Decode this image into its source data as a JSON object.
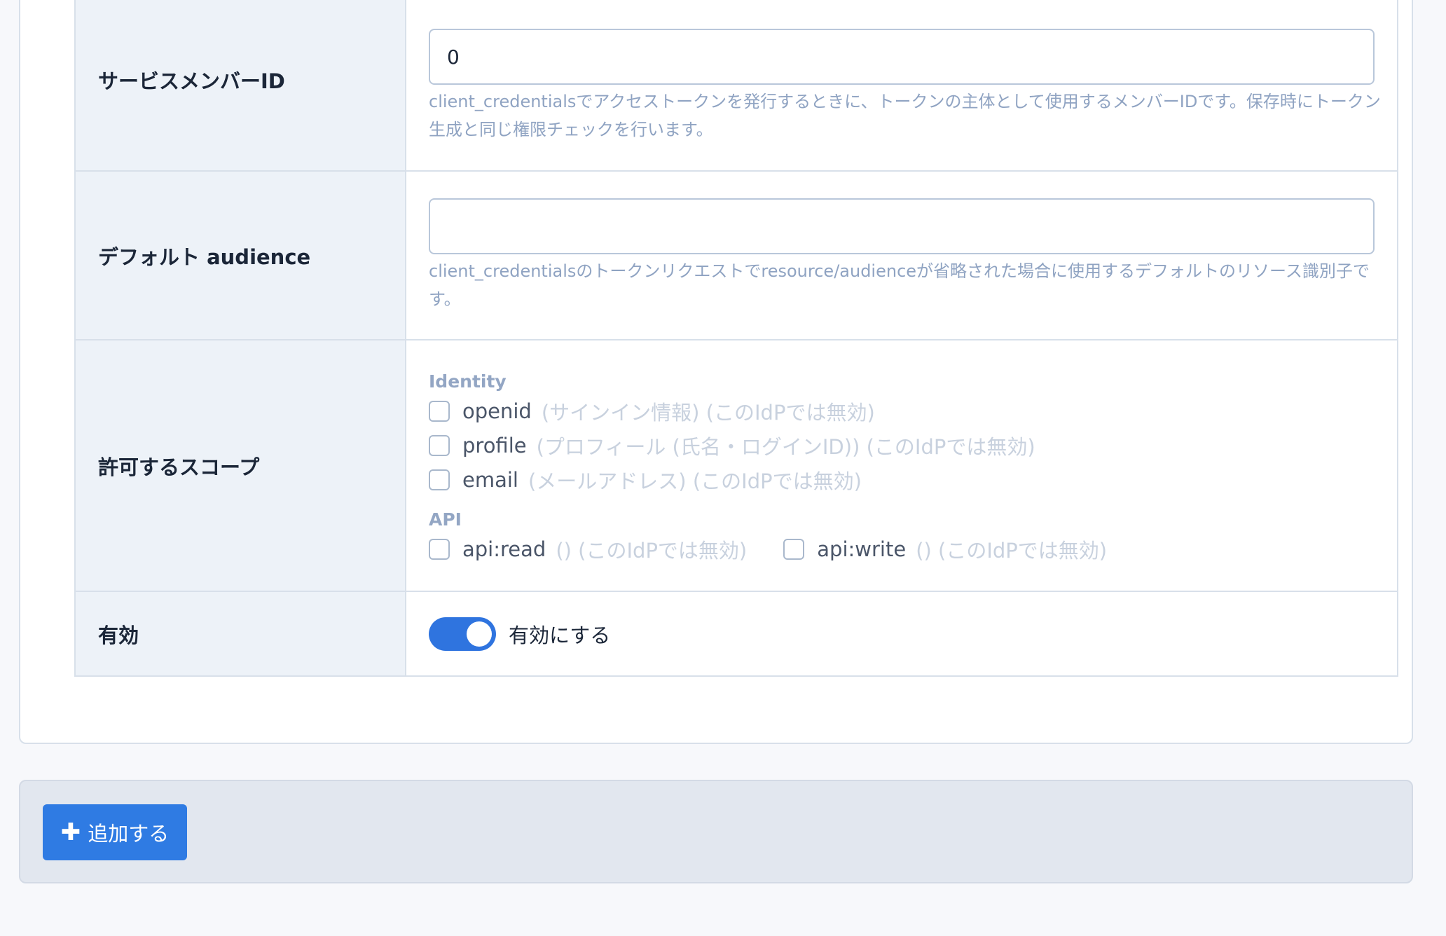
{
  "rows": {
    "service_member": {
      "label": "サービスメンバーID",
      "value": "0",
      "help": "client_credentialsでアクセストークンを発行するときに、トークンの主体として使用するメンバーIDです。保存時にトークン生成と同じ権限チェックを行います。"
    },
    "audience": {
      "label": "デフォルト audience",
      "value": "",
      "help": "client_credentialsのトークンリクエストでresource/audienceが省略された場合に使用するデフォルトのリソース識別子です。"
    },
    "scopes": {
      "label": "許可するスコープ",
      "groups": [
        {
          "title": "Identity",
          "items": [
            {
              "name": "openid",
              "desc": "(サインイン情報) (このIdPでは無効)",
              "checked": false
            },
            {
              "name": "profile",
              "desc": "(プロフィール (氏名・ログインID)) (このIdPでは無効)",
              "checked": false
            },
            {
              "name": "email",
              "desc": "(メールアドレス) (このIdPでは無効)",
              "checked": false
            }
          ]
        },
        {
          "title": "API",
          "items": [
            {
              "name": "api:read",
              "desc": "() (このIdPでは無効)",
              "checked": false
            },
            {
              "name": "api:write",
              "desc": "() (このIdPでは無効)",
              "checked": false
            }
          ]
        }
      ]
    },
    "enabled": {
      "label": "有効",
      "toggle_label": "有効にする",
      "on": true
    }
  },
  "footer": {
    "add_button_label": "追加する",
    "add_icon": "plus-icon"
  },
  "colors": {
    "accent": "#2f7be3",
    "toggle_on": "#2f74df",
    "label_bg": "#edf2f8"
  }
}
